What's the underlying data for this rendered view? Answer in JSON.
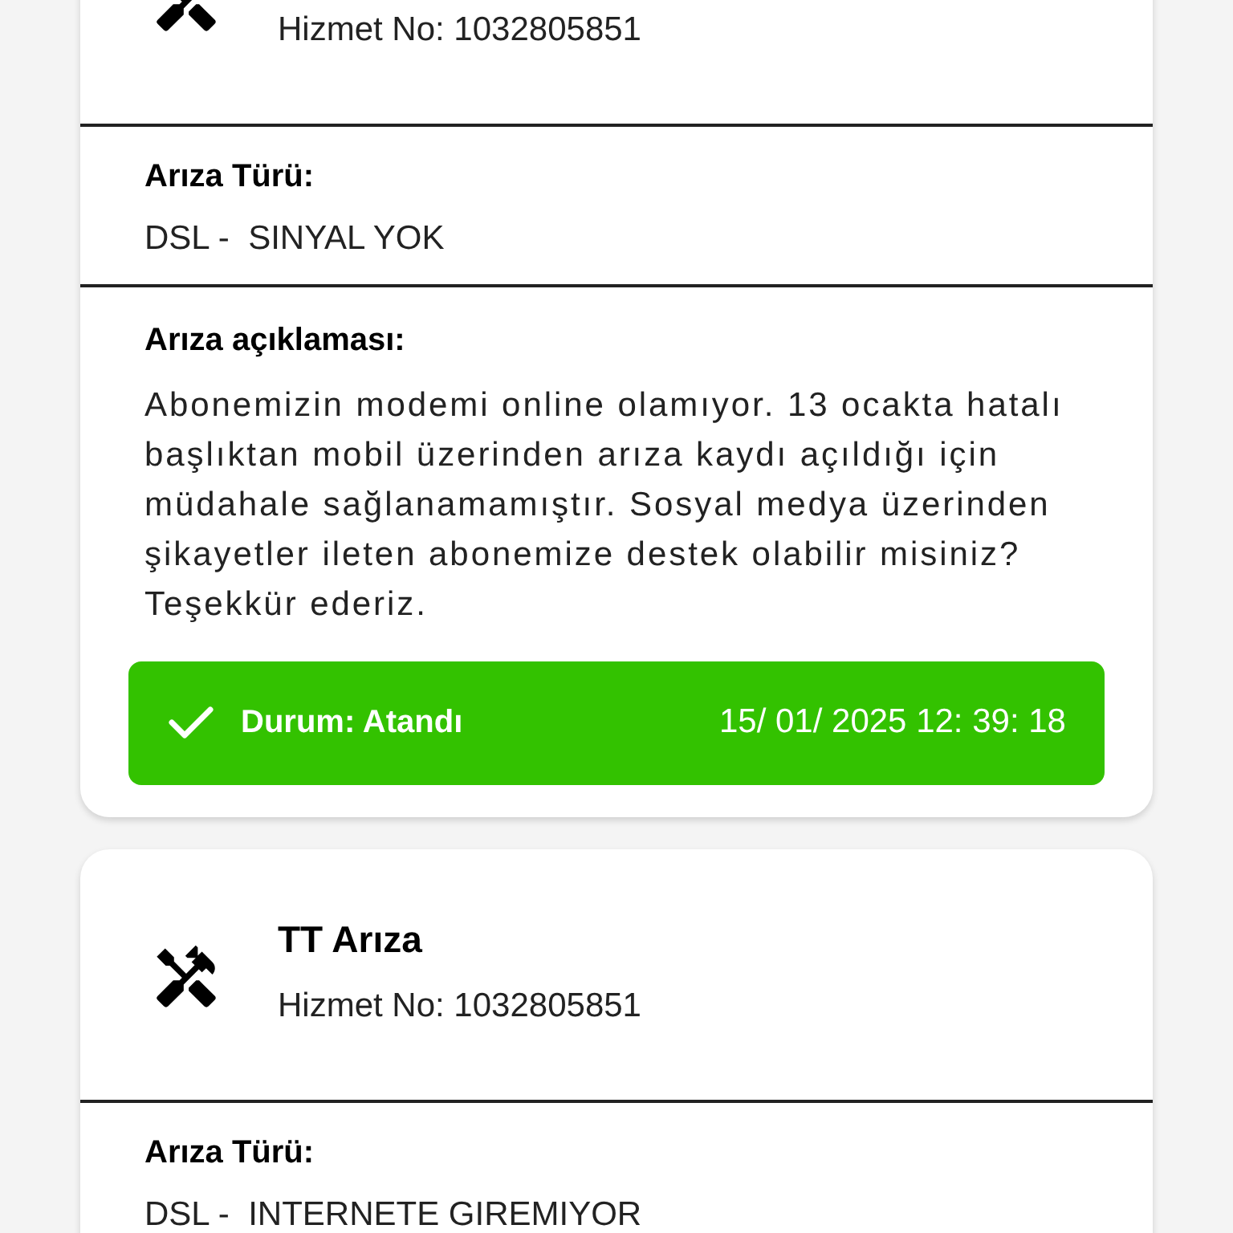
{
  "cards": [
    {
      "service_no": "Hizmet No: 1032805851",
      "fault_type_label": "Arıza Türü:",
      "fault_type": "DSL -  SINYAL YOK",
      "description_label": "Arıza açıklaması:",
      "description": "Abonemizin modemi online olamıyor. 13 ocakta hatalı başlıktan mobil üzerinden arıza kaydı açıldığı için müdahale sağlanamamıştır. Sosyal medya üzerinden şikayetler ileten abonemize destek olabilir misiniz? Teşekkür ederiz.",
      "status": {
        "kind": "assigned",
        "label": "Durum: Atandı",
        "timestamp": "15/ 01/ 2025 12: 39: 18"
      }
    },
    {
      "title": "TT Arıza",
      "service_no": "Hizmet No: 1032805851",
      "fault_type_label": "Arıza Türü:",
      "fault_type": "DSL -  INTERNETE GIREMIYOR"
    }
  ]
}
